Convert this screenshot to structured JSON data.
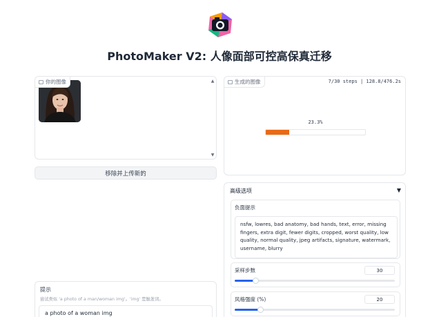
{
  "header": {
    "title": "PhotoMaker V2: 人像面部可控高保真迁移",
    "logo_icon": "camera-logo-icon",
    "logo_colors": [
      "#f59e0b",
      "#ec4899",
      "#6366f1",
      "#10b981"
    ]
  },
  "gallery": {
    "label": "你的图像",
    "label_icon": "image-icon",
    "upload_new_button": "移除并上传新的"
  },
  "output": {
    "label": "生成的图像",
    "label_icon": "image-icon",
    "status": "7/30 steps | 128.8/476.2s",
    "progress_label": "23.3%",
    "progress_fraction": 0.233,
    "progress_color": "#ea6a15"
  },
  "advanced": {
    "title": "高级选项",
    "toggle_icon": "triangle-down-icon",
    "negative_prompt_label": "负面提示",
    "negative_prompt_value": "nsfw, lowres, bad anatomy, bad hands, text, error, missing fingers, extra digit, fewer digits, cropped, worst quality, low quality, normal quality, jpeg artifacts, signature, watermark, username, blurry",
    "steps_label": "采样步数",
    "steps_value": "30",
    "steps_fraction": 0.13,
    "style_strength_label": "风格强度 (%)",
    "style_strength_value": "20",
    "style_strength_fraction": 0.16
  },
  "prompt": {
    "label": "提示",
    "hint": "尝试类似 'a photo of a man/woman img'。'img' 是触发词。",
    "value": "a photo of a woman img"
  }
}
